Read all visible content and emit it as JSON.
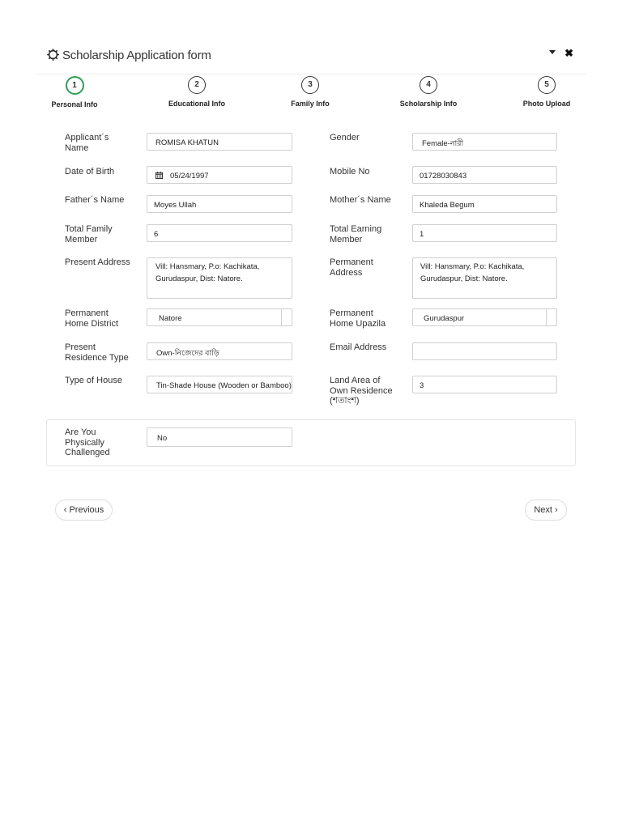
{
  "header": {
    "title": "Scholarship Application form",
    "close_glyph": "✖"
  },
  "steps": [
    {
      "num": "1",
      "label": "Personal Info",
      "active": true
    },
    {
      "num": "2",
      "label": "Educational Info"
    },
    {
      "num": "3",
      "label": "Family Info"
    },
    {
      "num": "4",
      "label": "Scholarship Info"
    },
    {
      "num": "5",
      "label": "Photo Upload"
    }
  ],
  "form": {
    "applicant_name": {
      "label": "Applicant´s Name",
      "value": "ROMISA KHATUN"
    },
    "gender": {
      "label": "Gender",
      "value": "Female-নারী"
    },
    "dob": {
      "label": "Date of Birth",
      "value": "05/24/1997"
    },
    "mobile": {
      "label": "Mobile No",
      "value": "01728030843"
    },
    "father_name": {
      "label": "Father´s Name",
      "value": "Moyes Ullah"
    },
    "mother_name": {
      "label": "Mother´s Name",
      "value": "Khaleda Begum"
    },
    "total_family": {
      "label": "Total Family Member",
      "value": "6"
    },
    "total_earning": {
      "label": "Total Earning Member",
      "value": "1"
    },
    "present_address": {
      "label": "Present Address",
      "value": "Vill: Hansmary, P.o: Kachikata, Gurudaspur, Dist: Natore."
    },
    "permanent_address": {
      "label": "Permanent Address",
      "value": "Vill: Hansmary, P.o: Kachikata, Gurudaspur, Dist: Natore."
    },
    "home_district": {
      "label": "Permanent Home District",
      "value": "Natore"
    },
    "home_upazila": {
      "label": "Permanent Home Upazila",
      "value": "Gurudaspur"
    },
    "residence_type": {
      "label": "Present Residence Type",
      "value": "Own-নিজেদের বাড়ি"
    },
    "email": {
      "label": "Email Address",
      "value": ""
    },
    "house_type": {
      "label": "Type of House",
      "value": "Tin-Shade House (Wooden or Bamboo)"
    },
    "land_area": {
      "label": "Land Area of Own Residence (শতাংশ)",
      "value": "3"
    },
    "physically_challenged": {
      "label": "Are You Physically Challenged",
      "value": "No"
    }
  },
  "nav": {
    "previous": "‹ Previous",
    "next": "Next ›"
  },
  "colors": {
    "accent": "#2e9e57",
    "border": "#d0d0d0"
  }
}
